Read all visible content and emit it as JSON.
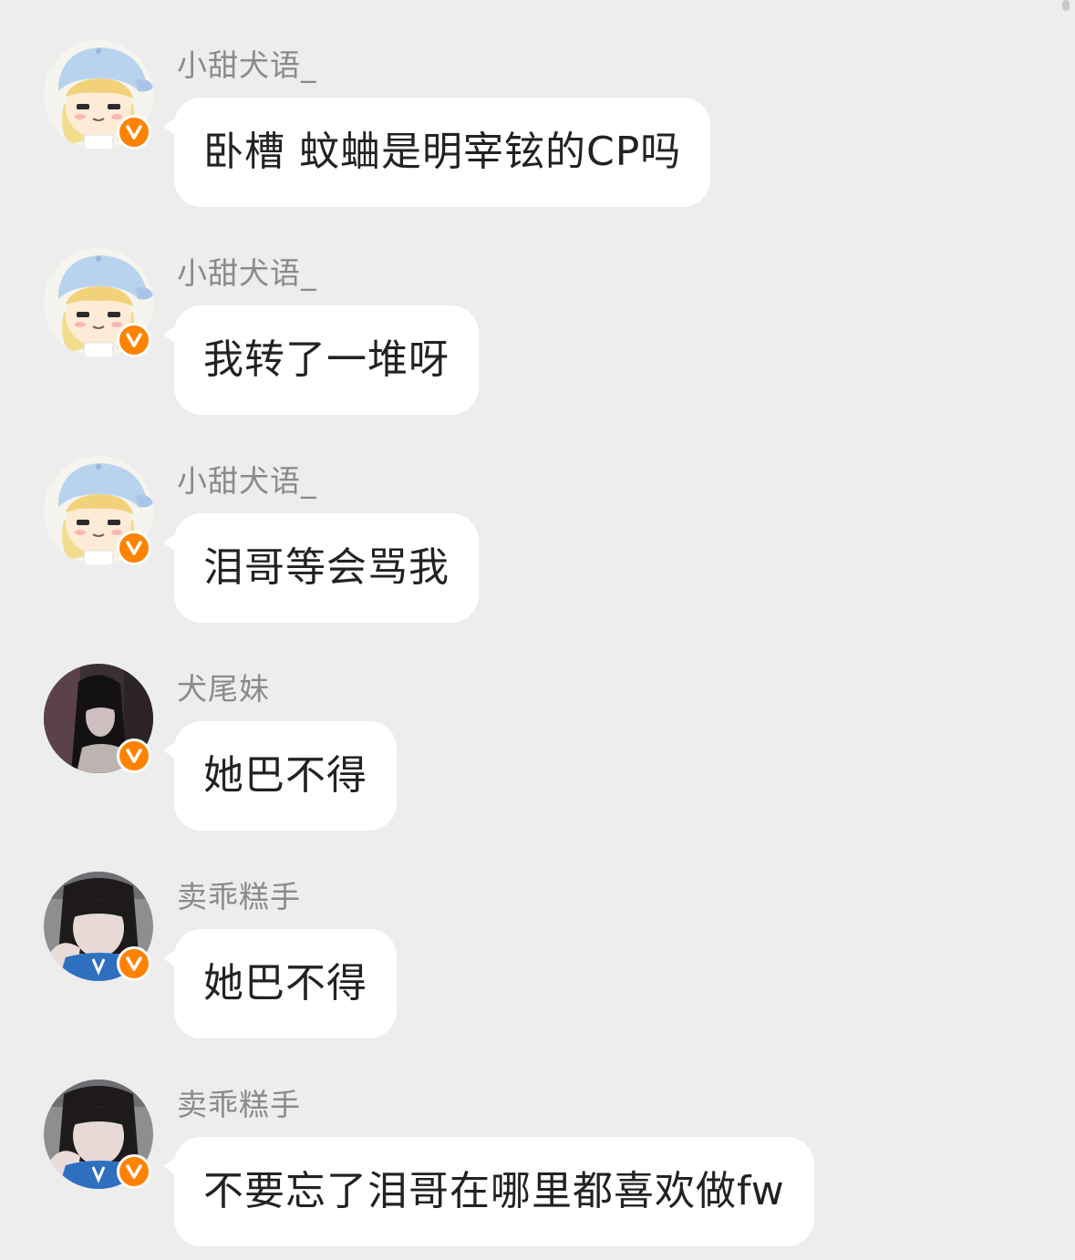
{
  "messages": [
    {
      "sender": "小甜犬语_",
      "avatar": "cartoon-girl-cap-avatar",
      "verified": true,
      "text": "卧槽 蚊蛐是明宰铉的CP吗"
    },
    {
      "sender": "小甜犬语_",
      "avatar": "cartoon-girl-cap-avatar",
      "verified": true,
      "text": "我转了一堆呀"
    },
    {
      "sender": "小甜犬语_",
      "avatar": "cartoon-girl-cap-avatar",
      "verified": true,
      "text": "泪哥等会骂我"
    },
    {
      "sender": "犬尾妹",
      "avatar": "dark-photo-girl-avatar",
      "verified": true,
      "text": "她巴不得"
    },
    {
      "sender": "卖乖糕手",
      "avatar": "selfie-girl-avatar",
      "verified": true,
      "text": "她巴不得"
    },
    {
      "sender": "卖乖糕手",
      "avatar": "selfie-girl-avatar",
      "verified": true,
      "text": "不要忘了泪哥在哪里都喜欢做fw"
    }
  ],
  "colors": {
    "background": "#ededed",
    "bubble": "#ffffff",
    "badge": "#ff8200",
    "name": "#8a8a8a",
    "text": "#222222"
  }
}
